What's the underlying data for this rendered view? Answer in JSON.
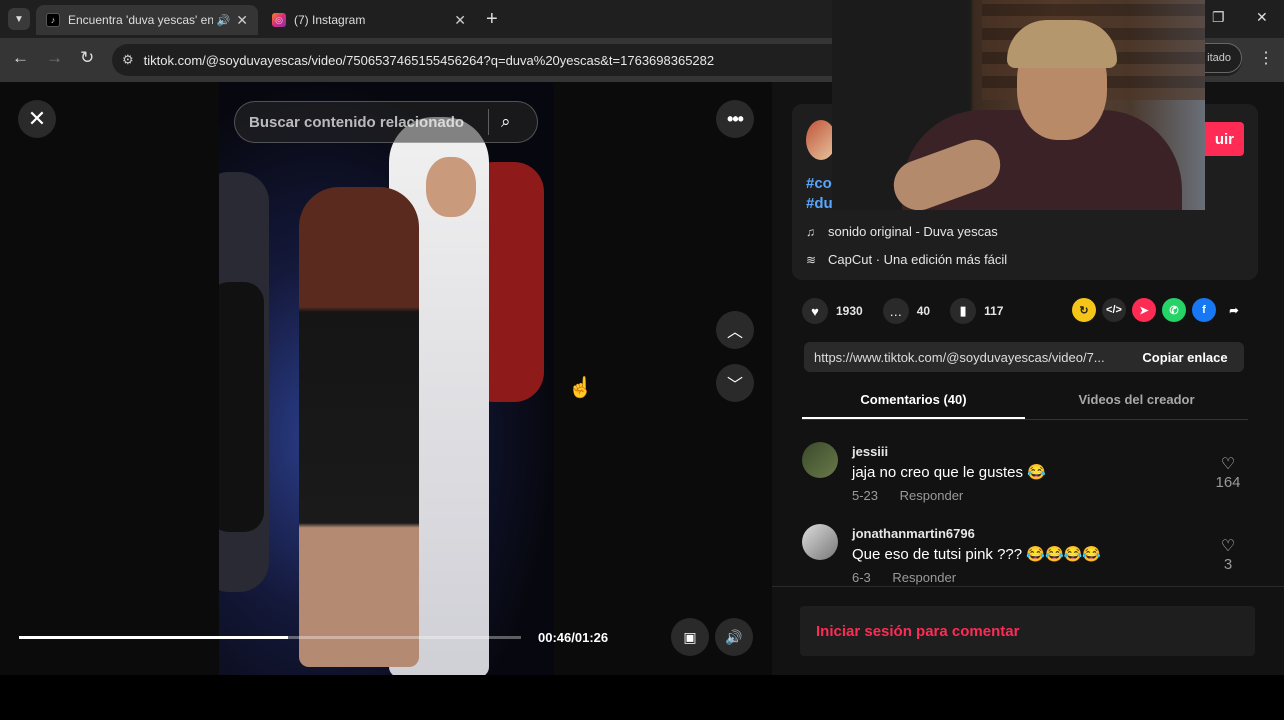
{
  "browser": {
    "tabs": [
      {
        "title": "Encuentra 'duva yescas' en",
        "active": true
      },
      {
        "title": "(7) Instagram",
        "active": false
      }
    ],
    "url": "tiktok.com/@soyduvayescas/video/7506537465155456264?q=duva%20yescas&t=1763698365282",
    "profile_label": "itado"
  },
  "video": {
    "search_placeholder": "Buscar contenido relacionado",
    "time": "00:46/01:26",
    "progress": 0.535
  },
  "post": {
    "hashtags": [
      "#co",
      "#du"
    ],
    "follow_label": "uir",
    "sound": "sonido original - Duva yescas",
    "capcut": "CapCut · Una edición más fácil",
    "likes": "1930",
    "comments": "40",
    "saves": "117",
    "link": "https://www.tiktok.com/@soyduvayescas/video/7...",
    "copy_label": "Copiar enlace"
  },
  "tabs": {
    "comments": "Comentarios (40)",
    "creator": "Videos del creador"
  },
  "comments": [
    {
      "user": "jessiii",
      "text": "jaja no creo que le gustes 😂",
      "date": "5-23",
      "reply": "Responder",
      "likes": "164"
    },
    {
      "user": "jonathanmartin6796",
      "text": "Que eso de tutsi pink ??? 😂😂😂😂",
      "date": "6-3",
      "reply": "Responder",
      "likes": "3"
    }
  ],
  "login": "Iniciar sesión para comentar",
  "colors": {
    "accent": "#fe2c55",
    "hashtag": "#5aa6ff",
    "background": "#121212"
  }
}
